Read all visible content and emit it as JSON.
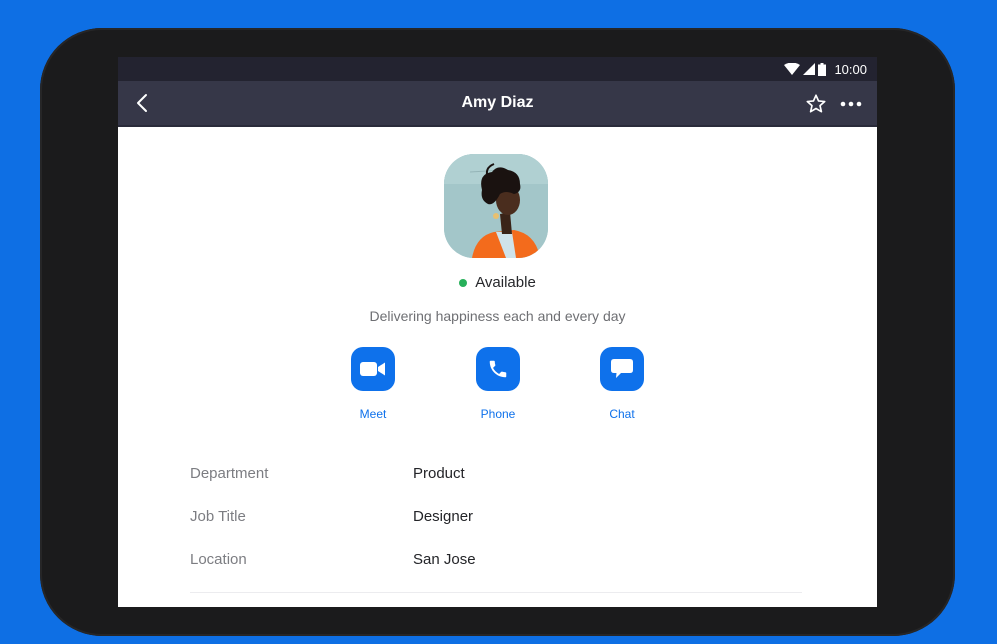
{
  "status_bar": {
    "time": "10:00",
    "icons": [
      "wifi-icon",
      "cellular-signal-icon",
      "battery-icon"
    ]
  },
  "app_bar": {
    "title": "Amy Diaz",
    "back_icon": "chevron-left-icon",
    "favorite_icon": "star-outline-icon",
    "more_icon": "more-horizontal-icon"
  },
  "profile": {
    "name": "Amy Diaz",
    "presence": {
      "label": "Available",
      "color": "#27b05a"
    },
    "status_message": "Delivering happiness each and every day"
  },
  "actions": [
    {
      "label": "Meet",
      "icon": "video-camera-icon"
    },
    {
      "label": "Phone",
      "icon": "phone-icon"
    },
    {
      "label": "Chat",
      "icon": "chat-bubble-icon"
    }
  ],
  "details": [
    {
      "label": "Department",
      "value": "Product"
    },
    {
      "label": "Job Title",
      "value": "Designer"
    },
    {
      "label": "Location",
      "value": "San Jose"
    }
  ],
  "colors": {
    "background": "#0e6fe4",
    "accent": "#0e71eb",
    "app_bar": "#363748",
    "status_bar": "#232330",
    "device": "#1b1b1c"
  }
}
